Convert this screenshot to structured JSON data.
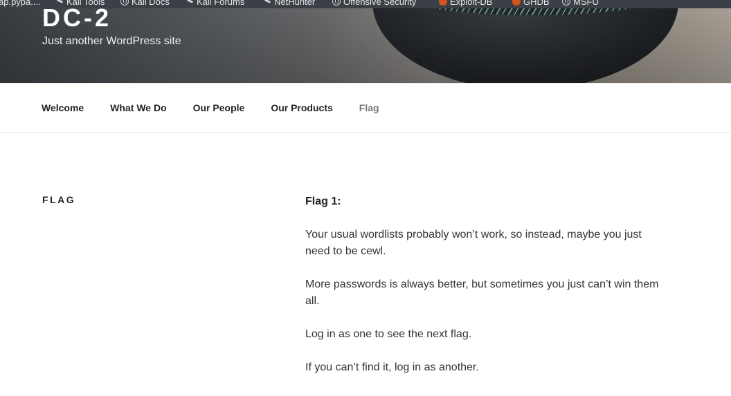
{
  "bookmarks": [
    {
      "label": "ap.pypa....",
      "icon": "none"
    },
    {
      "label": "Kali Tools",
      "icon": "kali-dragon-icon"
    },
    {
      "label": "Kali Docs",
      "icon": "globe-icon"
    },
    {
      "label": "Kali Forums",
      "icon": "kali-dragon-icon"
    },
    {
      "label": "NetHunter",
      "icon": "kali-dragon-icon"
    },
    {
      "label": "Offensive Security",
      "icon": "globe-icon"
    },
    {
      "label": "Exploit-DB",
      "icon": "exploit-db-icon"
    },
    {
      "label": "GHDB",
      "icon": "exploit-db-icon"
    },
    {
      "label": "MSFU",
      "icon": "globe-icon"
    }
  ],
  "header": {
    "title": "DC-2",
    "description": "Just another WordPress site"
  },
  "nav": {
    "items": [
      {
        "label": "Welcome"
      },
      {
        "label": "What We Do"
      },
      {
        "label": "Our People"
      },
      {
        "label": "Our Products"
      },
      {
        "label": "Flag"
      }
    ],
    "current": "Flag"
  },
  "page": {
    "title": "FLAG",
    "heading": "Flag 1:",
    "paragraphs": [
      "Your usual wordlists probably won’t work, so instead, maybe you just need to be cewl.",
      "More passwords is always better, but sometimes you just can’t win them all.",
      "Log in as one to see the next flag.",
      "If you can’t find it, log in as another."
    ]
  },
  "colors": {
    "nav_current": "#767676",
    "text": "#333333",
    "header_text": "#ffffff"
  }
}
